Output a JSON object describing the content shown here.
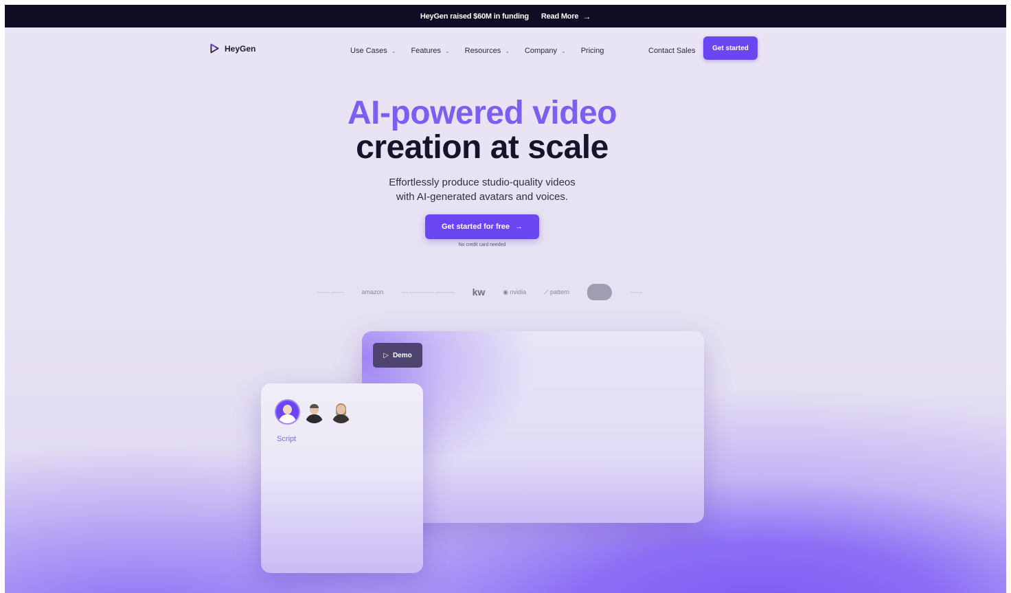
{
  "announcement": {
    "text": "HeyGen raised $60M in funding",
    "link_label": "Read More",
    "arrow": "→"
  },
  "nav": {
    "brand": "HeyGen",
    "items": [
      {
        "label": "Use Cases",
        "has_dropdown": true
      },
      {
        "label": "Features",
        "has_dropdown": true
      },
      {
        "label": "Resources",
        "has_dropdown": true
      },
      {
        "label": "Company",
        "has_dropdown": true
      },
      {
        "label": "Pricing",
        "has_dropdown": false
      }
    ],
    "contact_label": "Contact Sales",
    "cta_label": "Get started",
    "chevron": "⌄"
  },
  "hero": {
    "title_line1": "AI-powered video",
    "title_line2": "creation at scale",
    "subtitle_line1": "Effortlessly produce studio-quality videos",
    "subtitle_line2": "with AI-generated avatars and voices.",
    "cta_label": "Get started for free",
    "cta_arrow": "→",
    "note": "No credit card needed"
  },
  "logos": {
    "amazon": "amazon",
    "kw": "kw",
    "nvidia": "nvidia",
    "pattern": "pattern"
  },
  "demo": {
    "button_label": "Demo",
    "play_glyph": "▷"
  },
  "script_card": {
    "label": "Script"
  },
  "colors": {
    "accent": "#6a45f2",
    "title_purple": "#7d5df2",
    "topbar": "#0f0c24"
  }
}
